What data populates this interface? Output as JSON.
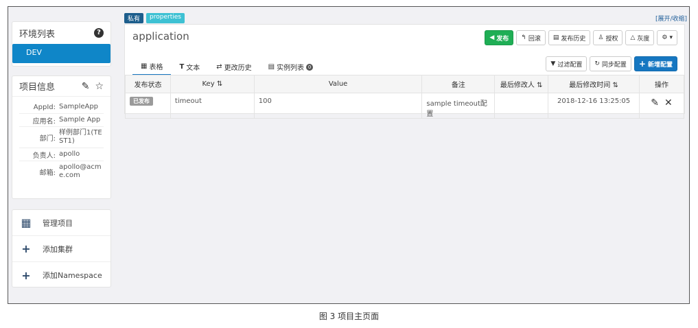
{
  "env_list": {
    "title": "环境列表",
    "help_icon": "?",
    "items": [
      "DEV"
    ]
  },
  "project_info": {
    "title": "项目信息",
    "rows": [
      {
        "key": "AppId:",
        "value": "SampleApp"
      },
      {
        "key": "应用名:",
        "value": "Sample App"
      },
      {
        "key": "部门:",
        "value": "样例部门1(TEST1)"
      },
      {
        "key": "负责人:",
        "value": "apollo"
      },
      {
        "key": "邮箱:",
        "value": "apollo@acme.com"
      }
    ]
  },
  "actions": [
    {
      "icon": "grid-icon",
      "label": "管理项目"
    },
    {
      "icon": "plus-icon",
      "label": "添加集群"
    },
    {
      "icon": "plus-icon",
      "label": "添加Namespace"
    }
  ],
  "namespace": {
    "tags": [
      "私有",
      "properties"
    ],
    "toggle": "[展开/收缩]",
    "name": "application",
    "buttons": [
      "发布",
      "回滚",
      "发布历史",
      "授权",
      "灰度"
    ],
    "secondary_buttons": [
      "过滤配置",
      "同步配置",
      "新增配置"
    ],
    "tabs": [
      {
        "label": "表格",
        "icon": "table-icon"
      },
      {
        "label": "文本",
        "icon": "text-icon"
      },
      {
        "label": "更改历史",
        "icon": "swap-icon"
      },
      {
        "label": "实例列表",
        "icon": "server-icon",
        "badge": "0"
      }
    ],
    "columns": [
      "发布状态",
      "Key",
      "Value",
      "备注",
      "最后修改人",
      "最后修改时间",
      "操作"
    ],
    "rows": [
      {
        "status": "已发布",
        "key": "timeout",
        "value": "100",
        "comment": "sample timeout配置",
        "modifier": "",
        "time": "2018-12-16 13:25:05"
      }
    ]
  },
  "caption": "图 3 项目主页面",
  "colors": {
    "primary": "#1677c1",
    "success": "#1fae55",
    "env_active": "#0f86c8"
  }
}
